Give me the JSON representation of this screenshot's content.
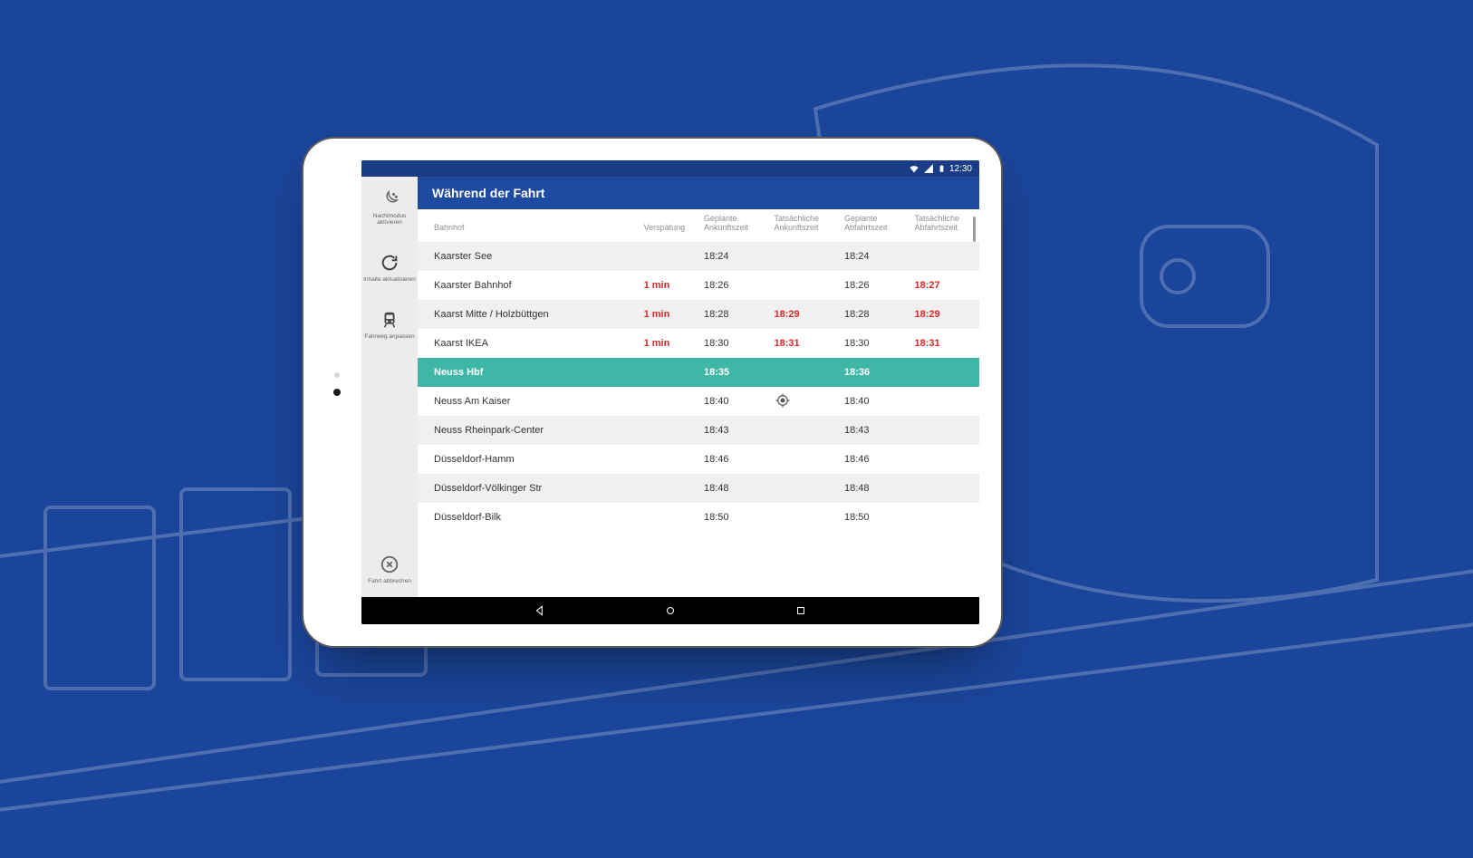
{
  "status": {
    "time": "12:30"
  },
  "sidebar": {
    "items": [
      {
        "icon": "night-icon",
        "label": "Nachtmodus\naktivieren"
      },
      {
        "icon": "refresh-icon",
        "label": "Inhalte\naktualisieren"
      },
      {
        "icon": "train-icon",
        "label": "Fahrweg\nanpassen"
      }
    ],
    "close": {
      "icon": "close-circle-icon",
      "label": "Fahrt\nabbrechen"
    }
  },
  "title": "Während der Fahrt",
  "colors": {
    "primary": "#1f4aa2",
    "accent": "#3fb7a7",
    "delay": "#d62a2a"
  },
  "headers": {
    "bahnhof": "Bahnhof",
    "verspaetung": "Verspätung",
    "geplante_ankunft": "Geplante\nAnkunftszeit",
    "tatsaechliche_ankunft": "Tatsächliche\nAnkunftszeit",
    "geplante_abfahrt": "Geplante\nAbfahrtszeit",
    "tatsaechliche_abfahrt": "Tatsächliche\nAbfahrtszeit"
  },
  "rows": [
    {
      "bahnhof": "Kaarster See",
      "verspaetung": "",
      "ga": "18:24",
      "ta": "",
      "gd": "18:24",
      "td": "",
      "active": false,
      "locate": false
    },
    {
      "bahnhof": "Kaarster Bahnhof",
      "verspaetung": "1 min",
      "ga": "18:26",
      "ta": "",
      "gd": "18:26",
      "td": "18:27",
      "active": false,
      "locate": false
    },
    {
      "bahnhof": "Kaarst Mitte / Holzbüttgen",
      "verspaetung": "1 min",
      "ga": "18:28",
      "ta": "18:29",
      "gd": "18:28",
      "td": "18:29",
      "active": false,
      "locate": false
    },
    {
      "bahnhof": "Kaarst IKEA",
      "verspaetung": "1 min",
      "ga": "18:30",
      "ta": "18:31",
      "gd": "18:30",
      "td": "18:31",
      "active": false,
      "locate": false
    },
    {
      "bahnhof": "Neuss Hbf",
      "verspaetung": "",
      "ga": "18:35",
      "ta": "",
      "gd": "18:36",
      "td": "",
      "active": true,
      "locate": false
    },
    {
      "bahnhof": "Neuss Am Kaiser",
      "verspaetung": "",
      "ga": "18:40",
      "ta": "",
      "gd": "18:40",
      "td": "",
      "active": false,
      "locate": true
    },
    {
      "bahnhof": "Neuss Rheinpark-Center",
      "verspaetung": "",
      "ga": "18:43",
      "ta": "",
      "gd": "18:43",
      "td": "",
      "active": false,
      "locate": false
    },
    {
      "bahnhof": "Düsseldorf-Hamm",
      "verspaetung": "",
      "ga": "18:46",
      "ta": "",
      "gd": "18:46",
      "td": "",
      "active": false,
      "locate": false
    },
    {
      "bahnhof": "Düsseldorf-Völkinger Str",
      "verspaetung": "",
      "ga": "18:48",
      "ta": "",
      "gd": "18:48",
      "td": "",
      "active": false,
      "locate": false
    },
    {
      "bahnhof": "Düsseldorf-Bilk",
      "verspaetung": "",
      "ga": "18:50",
      "ta": "",
      "gd": "18:50",
      "td": "",
      "active": false,
      "locate": false
    }
  ]
}
